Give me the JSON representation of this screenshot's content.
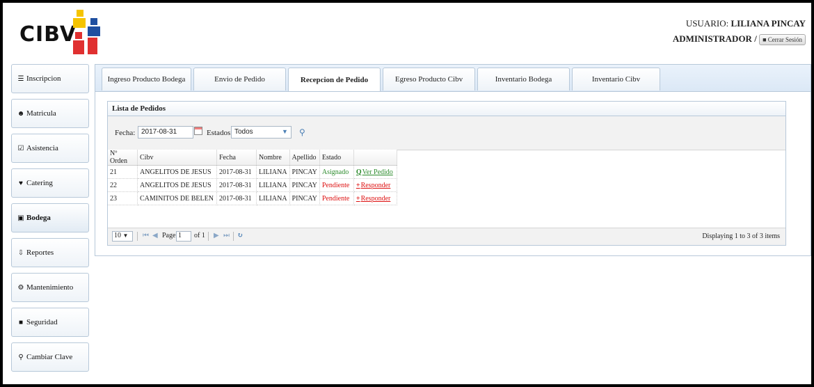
{
  "header": {
    "logo_text": "CIBV",
    "user_label": "USUARIO:",
    "user_name": "LILIANA PINCAY",
    "role": "ADMINISTRADOR /",
    "logout_label": "Cerrar Sesión"
  },
  "sidebar": {
    "items": [
      {
        "label": "Inscripcion",
        "icon": "list-icon"
      },
      {
        "label": "Matricula",
        "icon": "users-icon"
      },
      {
        "label": "Asistencia",
        "icon": "checkbox-icon"
      },
      {
        "label": "Catering",
        "icon": "cutlery-icon"
      },
      {
        "label": "Bodega",
        "icon": "archive-icon"
      },
      {
        "label": "Reportes",
        "icon": "download-icon"
      },
      {
        "label": "Mantenimiento",
        "icon": "gears-icon"
      },
      {
        "label": "Seguridad",
        "icon": "lock-icon"
      },
      {
        "label": "Cambiar Clave",
        "icon": "key-icon"
      }
    ],
    "active": "Bodega"
  },
  "tabs": [
    "Ingreso Producto Bodega",
    "Envio de Pedido",
    "Recepcion de Pedido",
    "Egreso Producto Cibv",
    "Inventario Bodega",
    "Inventario Cibv"
  ],
  "active_tab": "Recepcion de Pedido",
  "panel": {
    "title": "Lista de Pedidos",
    "filter": {
      "fecha_label": "Fecha:",
      "fecha_value": "2017-08-31",
      "estados_label": "Estados:",
      "estados_value": "Todos"
    },
    "columns": [
      "Nº Orden",
      "Cibv",
      "Fecha",
      "Nombre",
      "Apellido",
      "Estado",
      ""
    ],
    "rows": [
      {
        "orden": "21",
        "cibv": "ANGELITOS DE JESUS",
        "fecha": "2017-08-31",
        "nombre": "LILIANA",
        "apellido": "PINCAY",
        "estado": "Asignado",
        "accion": "Ver Pedido"
      },
      {
        "orden": "22",
        "cibv": "ANGELITOS DE JESUS",
        "fecha": "2017-08-31",
        "nombre": "LILIANA",
        "apellido": "PINCAY",
        "estado": "Pendiente",
        "accion": "Responder"
      },
      {
        "orden": "23",
        "cibv": "CAMINITOS DE BELEN",
        "fecha": "2017-08-31",
        "nombre": "LILIANA",
        "apellido": "PINCAY",
        "estado": "Pendiente",
        "accion": "Responder"
      }
    ],
    "pager": {
      "page_size": "10",
      "page_label": "Page",
      "page_value": "1",
      "of_label": "of 1",
      "info": "Displaying 1 to 3 of 3 items"
    }
  },
  "colors": {
    "asignado": "#2b8a2b",
    "pendiente": "#dd1111",
    "border": "#b7c8d9"
  }
}
